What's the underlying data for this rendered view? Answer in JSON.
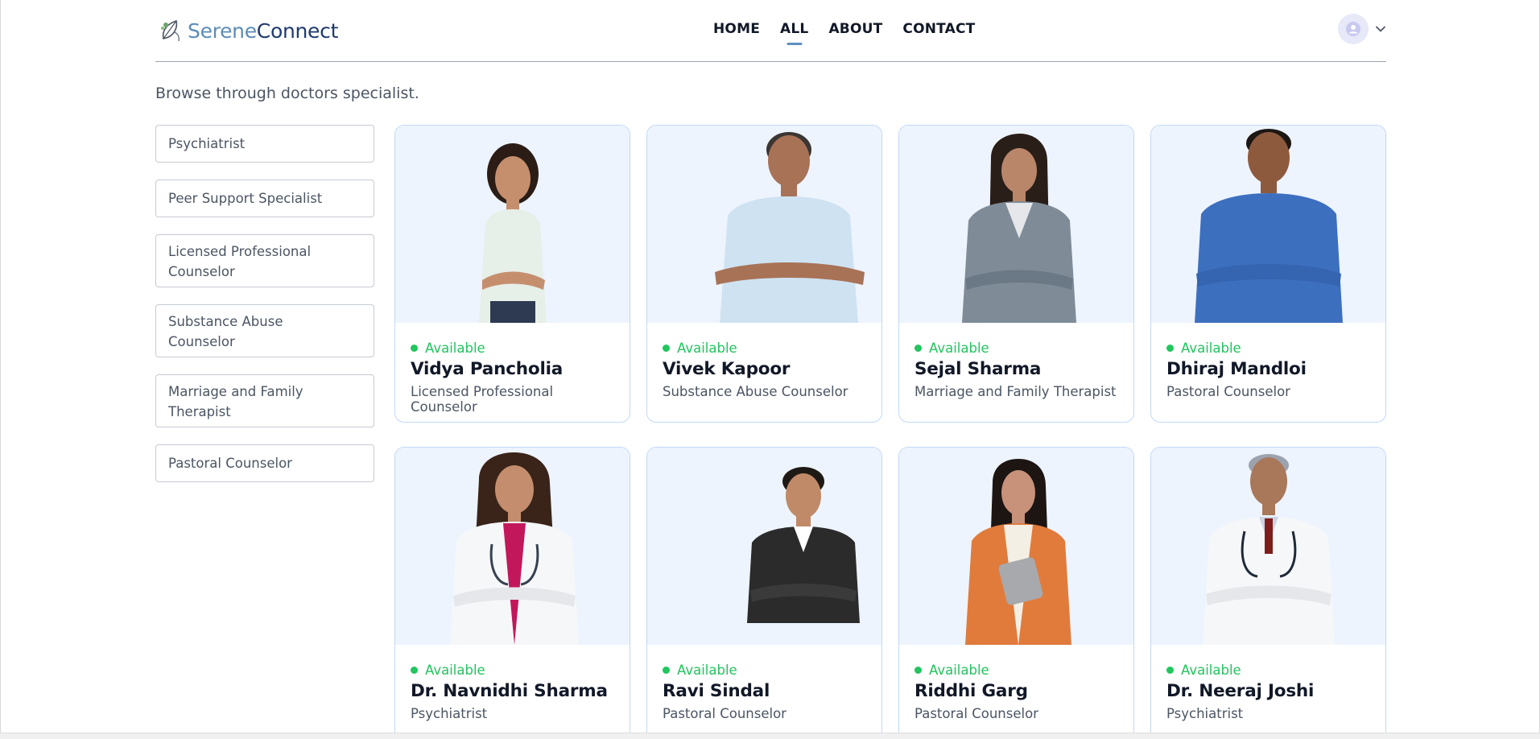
{
  "brand": {
    "part1": "Serene",
    "part2": "Connect",
    "accent": "#5f8fc0",
    "dark": "#1e3a6e"
  },
  "nav": {
    "items": [
      "HOME",
      "ALL",
      "ABOUT",
      "CONTACT"
    ],
    "active": "ALL"
  },
  "profile": {
    "icon": "user-avatar-icon",
    "dropdown_icon": "chevron-down-icon"
  },
  "subtitle": "Browse through doctors specialist.",
  "filters": [
    "Psychiatrist",
    "Peer Support Specialist",
    "Licensed Professional Counselor",
    "Substance Abuse Counselor",
    "Marriage and Family Therapist",
    "Pastoral Counselor"
  ],
  "doctors": [
    {
      "status": "Available",
      "name": "Vidya Pancholia",
      "speciality": "Licensed Professional Counselor"
    },
    {
      "status": "Available",
      "name": "Vivek Kapoor",
      "speciality": "Substance Abuse Counselor"
    },
    {
      "status": "Available",
      "name": "Sejal Sharma",
      "speciality": "Marriage and Family Therapist"
    },
    {
      "status": "Available",
      "name": "Dhiraj Mandloi",
      "speciality": "Pastoral Counselor"
    },
    {
      "status": "Available",
      "name": "Dr. Navnidhi Sharma",
      "speciality": "Psychiatrist"
    },
    {
      "status": "Available",
      "name": "Ravi Sindal",
      "speciality": "Pastoral Counselor"
    },
    {
      "status": "Available",
      "name": "Riddhi Garg",
      "speciality": "Pastoral Counselor"
    },
    {
      "status": "Available",
      "name": "Dr. Neeraj Joshi",
      "speciality": "Psychiatrist"
    }
  ],
  "colors": {
    "available": "#22c55e",
    "card_border": "#c2d9f5",
    "photo_bg": "#edf4fe"
  }
}
